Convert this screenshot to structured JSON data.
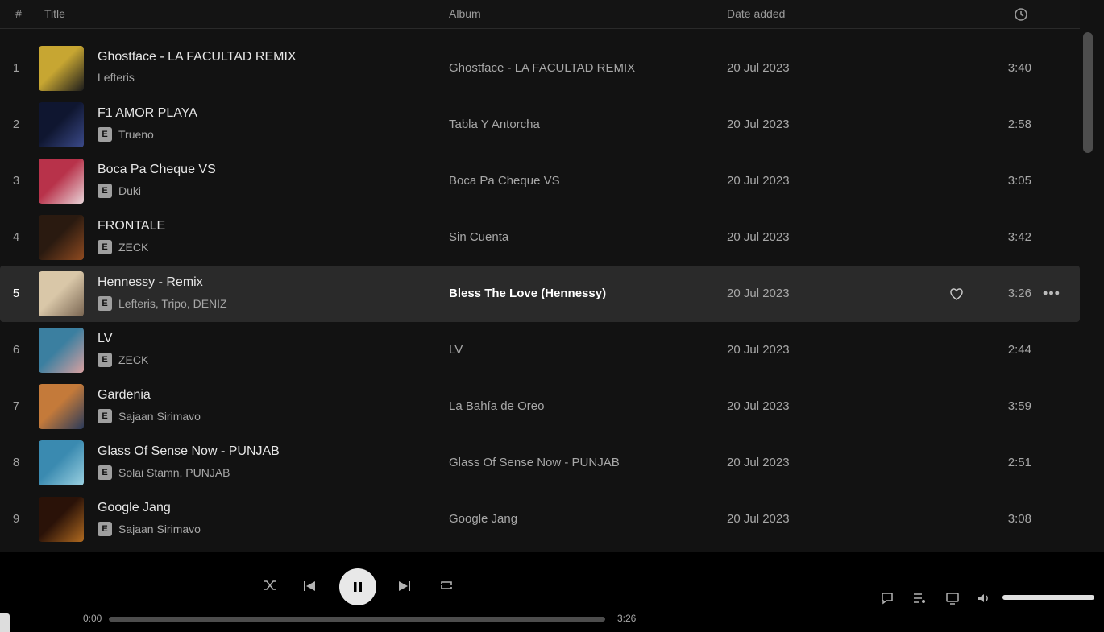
{
  "header": {
    "num": "#",
    "title": "Title",
    "album": "Album",
    "date": "Date added"
  },
  "tracks": [
    {
      "num": "1",
      "title": "Ghostface - LA FACULTAD REMIX",
      "artist": "Lefteris",
      "album": "Ghostface - LA FACULTAD REMIX",
      "date": "20 Jul 2023",
      "duration": "3:40",
      "explicit": false,
      "art": [
        "#c7a632",
        "#1c1c1c"
      ]
    },
    {
      "num": "2",
      "title": "F1 AMOR PLAYA",
      "artist": "Trueno",
      "album": "Tabla Y Antorcha",
      "date": "20 Jul 2023",
      "duration": "2:58",
      "explicit": true,
      "art": [
        "#0f1630",
        "#3b4a8a"
      ]
    },
    {
      "num": "3",
      "title": "Boca Pa Cheque VS",
      "artist": "Duki",
      "album": "Boca Pa Cheque VS",
      "date": "20 Jul 2023",
      "duration": "3:05",
      "explicit": true,
      "art": [
        "#b8324a",
        "#e8d4d8"
      ]
    },
    {
      "num": "4",
      "title": "FRONTALE",
      "artist": "ZECK",
      "album": "Sin Cuenta",
      "date": "20 Jul 2023",
      "duration": "3:42",
      "explicit": true,
      "art": [
        "#2a1a10",
        "#8f4a20"
      ]
    },
    {
      "num": "5",
      "title": "Hennessy - Remix",
      "artist": "Lefteris, Tripo, DENIZ",
      "album": "Bless The Love (Hennessy)",
      "date": "20 Jul 2023",
      "duration": "3:26",
      "explicit": true,
      "art": [
        "#d9c7a8",
        "#7a6652"
      ]
    },
    {
      "num": "6",
      "title": "LV",
      "artist": "ZECK",
      "album": "LV",
      "date": "20 Jul 2023",
      "duration": "2:44",
      "explicit": true,
      "art": [
        "#3b7fa0",
        "#d8a0a0"
      ]
    },
    {
      "num": "7",
      "title": "Gardenia",
      "artist": "Sajaan Sirimavo",
      "album": "La Bahía de Oreo",
      "date": "20 Jul 2023",
      "duration": "3:59",
      "explicit": true,
      "art": [
        "#c47a3a",
        "#2a3a5a"
      ]
    },
    {
      "num": "8",
      "title": "Glass Of Sense Now - PUNJAB",
      "artist": "Solai Stamn, PUNJAB",
      "album": "Glass Of Sense Now - PUNJAB",
      "date": "20 Jul 2023",
      "duration": "2:51",
      "explicit": true,
      "art": [
        "#3a8ab0",
        "#9ad0e0"
      ]
    },
    {
      "num": "9",
      "title": "Google Jang",
      "artist": "Sajaan Sirimavo",
      "album": "Google Jang",
      "date": "20 Jul 2023",
      "duration": "3:08",
      "explicit": true,
      "art": [
        "#2a1208",
        "#b06a20"
      ]
    }
  ],
  "hover_index": 4,
  "icons": {
    "num_header": "hash-icon",
    "duration_header": "clock-icon",
    "explicit": "explicit-icon",
    "heart": "heart-icon",
    "more": "more-icon",
    "shuffle": "shuffle-icon",
    "prev": "previous-icon",
    "play": "play-icon",
    "next": "next-icon",
    "repeat": "repeat-icon",
    "queue": "queue-icon",
    "device": "device-icon",
    "volume": "volume-icon"
  },
  "player": {
    "time_elapsed": "0:00",
    "time_total": "3:26",
    "progress": 0.0,
    "volume": 1.0
  }
}
